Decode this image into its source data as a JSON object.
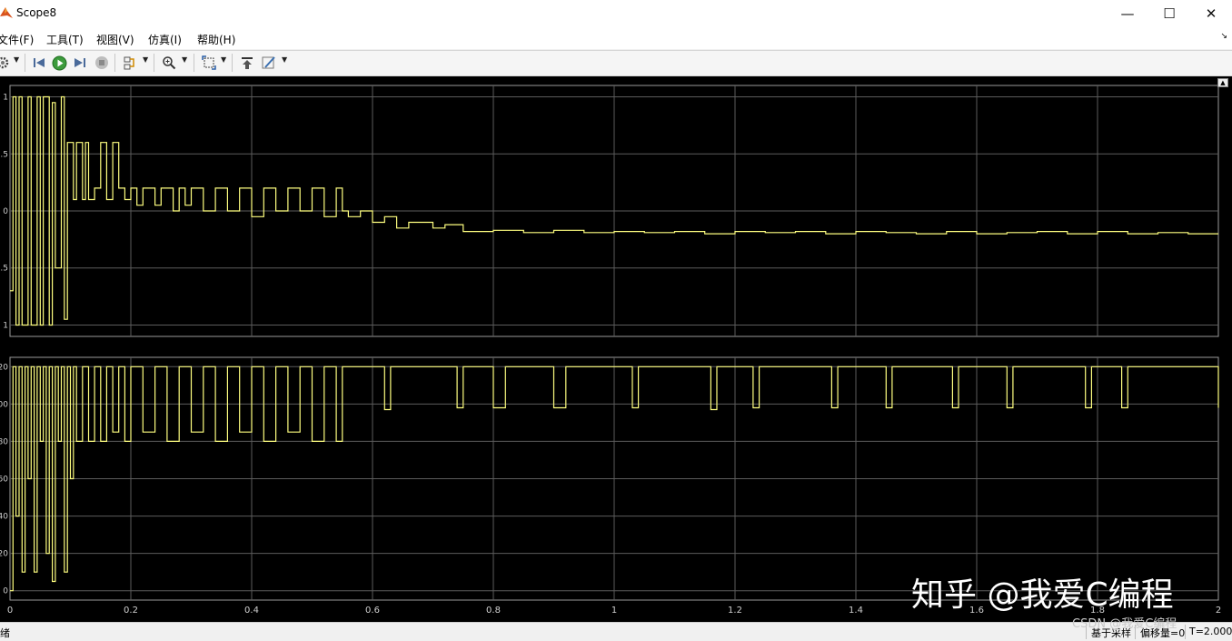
{
  "window": {
    "title": "Scope8",
    "controls": [
      "minimize-icon",
      "maximize-icon",
      "close-icon"
    ]
  },
  "menu": [
    {
      "label": "文件(F)"
    },
    {
      "label": "工具(T)"
    },
    {
      "label": "视图(V)"
    },
    {
      "label": "仿真(I)"
    },
    {
      "label": "帮助(H)"
    }
  ],
  "toolbar": {
    "icons": [
      "settings-icon",
      "step-back-icon",
      "run-icon",
      "step-forward-icon",
      "stop-icon",
      "highlight-icon",
      "zoom-in-icon",
      "autoscale-icon",
      "restore-icon",
      "style-icon"
    ]
  },
  "colors": {
    "scope_bg": "#000000",
    "plot_bg": "#000000",
    "axes_border": "#9a9a9a",
    "grid": "#5c5c5c",
    "tick_text": "#cfcfcf",
    "signal": "#ffff80"
  },
  "chart_data": [
    {
      "type": "line",
      "xlim": [
        0,
        2
      ],
      "ylim": [
        -1.1,
        1.1
      ],
      "x_ticks": [
        "0",
        "0.2",
        "0.4",
        "0.6",
        "0.8",
        "1",
        "1.2",
        "1.4",
        "1.6",
        "1.8",
        "2"
      ],
      "y_ticks": [
        {
          "value": 1,
          "label": "1"
        },
        {
          "value": 0.5,
          "label": ".5"
        },
        {
          "value": 0,
          "label": "0"
        },
        {
          "value": -0.5,
          "label": ".5"
        },
        {
          "value": -1,
          "label": "1"
        }
      ],
      "grid": true,
      "series": [
        {
          "x": [
            0,
            0.005,
            0.01,
            0.015,
            0.02,
            0.03,
            0.035,
            0.045,
            0.05,
            0.055,
            0.065,
            0.07,
            0.075,
            0.085,
            0.09,
            0.095,
            0.105,
            0.11,
            0.12,
            0.125,
            0.13,
            0.14,
            0.15,
            0.16,
            0.17,
            0.18,
            0.19,
            0.2,
            0.21,
            0.22,
            0.23,
            0.24,
            0.25,
            0.26,
            0.27,
            0.28,
            0.29,
            0.3,
            0.32,
            0.34,
            0.36,
            0.38,
            0.4,
            0.42,
            0.44,
            0.46,
            0.48,
            0.5,
            0.52,
            0.54,
            0.55,
            0.56,
            0.58,
            0.6,
            0.62,
            0.64,
            0.66,
            0.68,
            0.7,
            0.72,
            0.75,
            0.8,
            0.85,
            0.9,
            0.95,
            1.0,
            1.05,
            1.1,
            1.15,
            1.2,
            1.25,
            1.3,
            1.35,
            1.4,
            1.45,
            1.5,
            1.55,
            1.6,
            1.65,
            1.7,
            1.75,
            1.8,
            1.85,
            1.9,
            1.95,
            2.0
          ],
          "y": [
            -0.7,
            1.0,
            -1.0,
            1.0,
            -1.0,
            1.0,
            -1.0,
            1.0,
            -1.0,
            1.0,
            -1.0,
            0.95,
            -0.5,
            1.0,
            -0.95,
            0.6,
            0.1,
            0.6,
            0.1,
            0.6,
            0.1,
            0.2,
            0.6,
            0.1,
            0.6,
            0.2,
            0.1,
            0.2,
            0.05,
            0.2,
            0.2,
            0.05,
            0.2,
            0.2,
            0.0,
            0.2,
            0.05,
            0.2,
            0.0,
            0.2,
            0.0,
            0.2,
            -0.05,
            0.2,
            0.0,
            0.2,
            0.0,
            0.2,
            -0.05,
            0.2,
            0.0,
            -0.05,
            0.0,
            -0.1,
            -0.05,
            -0.15,
            -0.1,
            -0.1,
            -0.15,
            -0.12,
            -0.18,
            -0.17,
            -0.19,
            -0.17,
            -0.19,
            -0.18,
            -0.19,
            -0.18,
            -0.2,
            -0.18,
            -0.19,
            -0.18,
            -0.2,
            -0.18,
            -0.19,
            -0.2,
            -0.18,
            -0.2,
            -0.19,
            -0.18,
            -0.2,
            -0.18,
            -0.2,
            -0.19,
            -0.2,
            -0.2
          ]
        }
      ]
    },
    {
      "type": "line",
      "xlim": [
        0,
        2
      ],
      "ylim": [
        -5,
        125
      ],
      "x_ticks": [
        "0",
        "0.2",
        "0.4",
        "0.6",
        "0.8",
        "1",
        "1.2",
        "1.4",
        "1.6",
        "1.8",
        "2"
      ],
      "y_ticks": [
        {
          "value": 120,
          "label": "20"
        },
        {
          "value": 100,
          "label": "00"
        },
        {
          "value": 80,
          "label": "80"
        },
        {
          "value": 60,
          "label": "60"
        },
        {
          "value": 40,
          "label": "40"
        },
        {
          "value": 20,
          "label": "20"
        },
        {
          "value": 0,
          "label": "0"
        }
      ],
      "grid": true,
      "series": [
        {
          "x": [
            0,
            0.005,
            0.01,
            0.015,
            0.02,
            0.025,
            0.03,
            0.035,
            0.04,
            0.045,
            0.05,
            0.055,
            0.06,
            0.065,
            0.07,
            0.075,
            0.08,
            0.085,
            0.09,
            0.095,
            0.1,
            0.105,
            0.11,
            0.12,
            0.13,
            0.14,
            0.15,
            0.16,
            0.17,
            0.18,
            0.19,
            0.2,
            0.22,
            0.24,
            0.26,
            0.28,
            0.3,
            0.32,
            0.34,
            0.36,
            0.38,
            0.4,
            0.42,
            0.44,
            0.46,
            0.48,
            0.5,
            0.52,
            0.54,
            0.55,
            0.56,
            0.6,
            0.62,
            0.63,
            0.7,
            0.74,
            0.75,
            0.76,
            0.8,
            0.82,
            0.83,
            0.9,
            0.92,
            0.93,
            1.0,
            1.03,
            1.04,
            1.1,
            1.16,
            1.17,
            1.2,
            1.23,
            1.24,
            1.3,
            1.36,
            1.37,
            1.4,
            1.45,
            1.46,
            1.5,
            1.56,
            1.57,
            1.6,
            1.65,
            1.66,
            1.7,
            1.78,
            1.79,
            1.84,
            1.85,
            1.9,
            1.95,
            2.0
          ],
          "y": [
            0,
            120,
            40,
            120,
            10,
            120,
            60,
            120,
            10,
            120,
            80,
            120,
            20,
            120,
            5,
            120,
            80,
            120,
            10,
            120,
            60,
            120,
            80,
            120,
            80,
            120,
            80,
            120,
            85,
            120,
            80,
            120,
            85,
            120,
            80,
            120,
            85,
            120,
            80,
            120,
            85,
            120,
            80,
            120,
            85,
            120,
            80,
            120,
            80,
            120,
            120,
            120,
            97,
            120,
            120,
            98,
            120,
            120,
            98,
            120,
            120,
            98,
            120,
            120,
            120,
            98,
            120,
            120,
            97,
            120,
            120,
            98,
            120,
            120,
            98,
            120,
            120,
            98,
            120,
            120,
            98,
            120,
            120,
            98,
            120,
            120,
            98,
            120,
            98,
            120,
            120,
            120,
            98
          ]
        }
      ]
    }
  ],
  "status": {
    "ready": "绪",
    "mode": "基于采样",
    "offset": "偏移量=0",
    "time": "T=2.000"
  },
  "watermark": {
    "zhihu": "知乎 @我爱C编程",
    "csdn": "CSDN @我爱C编程"
  }
}
